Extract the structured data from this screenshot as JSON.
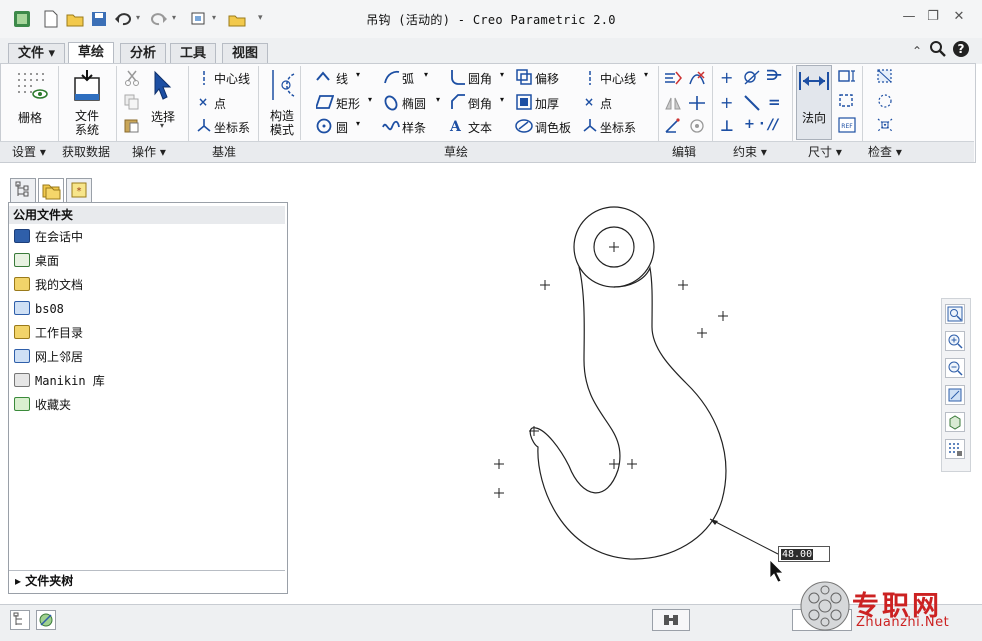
{
  "window": {
    "title": "吊钩 (活动的) - Creo Parametric 2.0",
    "controls": [
      "—",
      "❐",
      "✕"
    ]
  },
  "tabs": [
    {
      "label": "文件 ▾",
      "active": false
    },
    {
      "label": "草绘",
      "active": true
    },
    {
      "label": "分析",
      "active": false
    },
    {
      "label": "工具",
      "active": false
    },
    {
      "label": "视图",
      "active": false
    }
  ],
  "ribbon": {
    "grid_label": "栅格",
    "file_system_label_1": "文件",
    "file_system_label_2": "系统",
    "select_label": "选择",
    "datum_centerline": "中心线",
    "datum_point": "点",
    "datum_csys": "坐标系",
    "construction_mode_1": "构造",
    "construction_mode_2": "模式",
    "line": "线",
    "arc": "弧",
    "fillet": "圆角",
    "offset": "偏移",
    "centerline2": "中心线",
    "rectangle": "矩形",
    "ellipse": "椭圆",
    "chamfer": "倒角",
    "thicken": "加厚",
    "point2": "点",
    "circle": "圆",
    "spline": "样条",
    "text": "文本",
    "palette": "调色板",
    "csys2": "坐标系",
    "normal_label": "法向"
  },
  "groups": {
    "setup": "设置 ▾",
    "get_data": "获取数据",
    "operations": "操作 ▾",
    "datum": "基准",
    "sketching": "草绘",
    "editing": "编辑",
    "constrain": "约束 ▾",
    "dimension": "尺寸 ▾",
    "inspect": "检查 ▾"
  },
  "navigator": {
    "header": "公用文件夹",
    "items": [
      {
        "label": "在会话中",
        "icon": "session-icon",
        "color": "#2f5faa"
      },
      {
        "label": "桌面",
        "icon": "desktop-icon",
        "color": "#3a7a3a"
      },
      {
        "label": "我的文档",
        "icon": "my-documents-icon",
        "color": "#c9a227"
      },
      {
        "label": "bs08",
        "icon": "computer-icon",
        "color": "#2f5faa"
      },
      {
        "label": "工作目录",
        "icon": "working-directory-icon",
        "color": "#c9a227"
      },
      {
        "label": "网上邻居",
        "icon": "network-icon",
        "color": "#2f5faa"
      },
      {
        "label": "Manikin 库",
        "icon": "manikin-library-icon",
        "color": "#777777"
      },
      {
        "label": "收藏夹",
        "icon": "favorites-icon",
        "color": "#3a8a3a"
      }
    ],
    "tree_toggle": "▸ 文件夹树"
  },
  "sketch": {
    "dimension_value": "48.00"
  },
  "watermark": {
    "line1": "专职网",
    "line2": "Zhuanzhi.Net"
  },
  "colors": {
    "accent": "#2f5faa",
    "watermark": "#cc2222",
    "ribbon_bg": "#fbfbfc"
  }
}
